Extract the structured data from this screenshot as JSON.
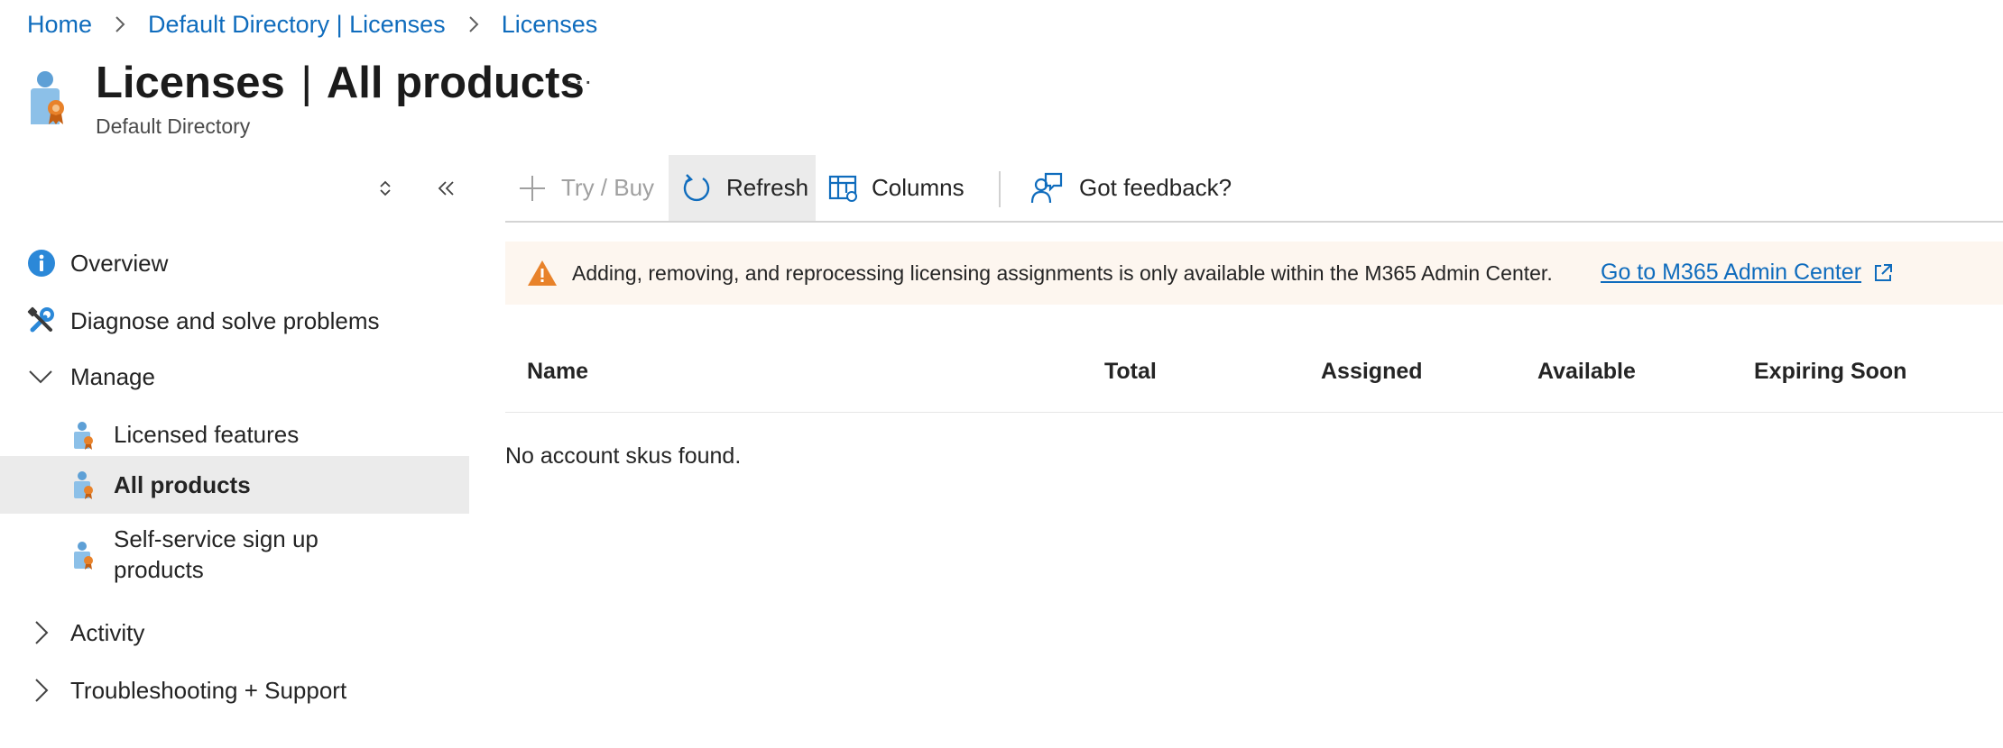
{
  "breadcrumb": {
    "items": [
      "Home",
      "Default Directory | Licenses",
      "Licenses"
    ]
  },
  "header": {
    "title_bold": "Licenses",
    "title_separator": "|",
    "title_rest": "All products",
    "subtitle": "Default Directory",
    "more_label": "···"
  },
  "sidebar": {
    "items": [
      {
        "label": "Overview",
        "icon": "info-icon"
      },
      {
        "label": "Diagnose and solve problems",
        "icon": "wrench-icon"
      },
      {
        "label": "Manage",
        "icon": "chevron-down-icon"
      },
      {
        "label": "Licensed features",
        "icon": "license-icon"
      },
      {
        "label": "All products",
        "icon": "license-icon",
        "selected": true
      },
      {
        "label": "Self-service sign up products",
        "icon": "license-icon"
      },
      {
        "label": "Activity",
        "icon": "chevron-right-icon"
      },
      {
        "label": "Troubleshooting + Support",
        "icon": "chevron-right-icon"
      }
    ]
  },
  "toolbar": {
    "try_buy": "Try / Buy",
    "refresh": "Refresh",
    "columns": "Columns",
    "feedback": "Got feedback?"
  },
  "banner": {
    "message": "Adding, removing, and reprocessing licensing assignments is only available within the M365 Admin Center.",
    "link": "Go to M365 Admin Center"
  },
  "table": {
    "columns": [
      "Name",
      "Total",
      "Assigned",
      "Available",
      "Expiring Soon"
    ],
    "empty_message": "No account skus found."
  },
  "colors": {
    "accent": "#0f6cbd",
    "selected_bg": "#ebebeb",
    "warning": "#e8822a",
    "banner_bg": "#fdf6ef"
  }
}
